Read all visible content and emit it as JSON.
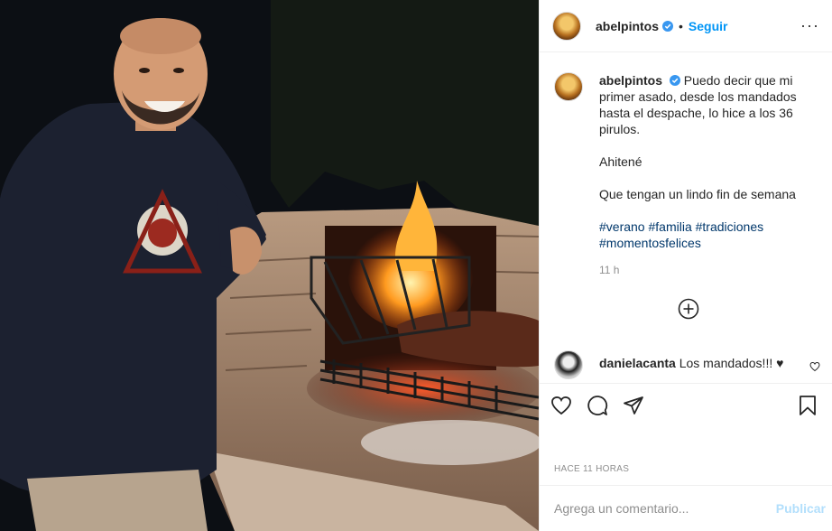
{
  "post": {
    "username": "abelpintos",
    "follow_label": "Seguir",
    "separator": "•",
    "more_label": "···",
    "caption": {
      "line1": "Puedo decir que mi primer asado, desde los mandados hasta el despache, lo hice a los 36 pirulos.",
      "line2": "Ahitené",
      "line3": "Que tengan un lindo fin de semana",
      "hashtags": [
        "#verano",
        "#familia",
        "#tradiciones",
        "#momentosfelices"
      ],
      "time": "11 h"
    },
    "comments": [
      {
        "username": "danielacanta",
        "text": "Los mandados!!! ♥"
      }
    ],
    "posted_ago": "HACE 11 HORAS",
    "comment_placeholder": "Agrega un comentario...",
    "publish_label": "Publicar"
  },
  "icons": {
    "verified": "verified-badge-icon",
    "like": "heart-icon",
    "comment": "comment-icon",
    "share": "send-icon",
    "save": "bookmark-icon",
    "load_more": "plus-circle-icon"
  },
  "colors": {
    "link_blue": "#0095f6",
    "hashtag": "#00376b",
    "muted": "#8e8e8e",
    "publish_disabled": "#b2dffc"
  }
}
